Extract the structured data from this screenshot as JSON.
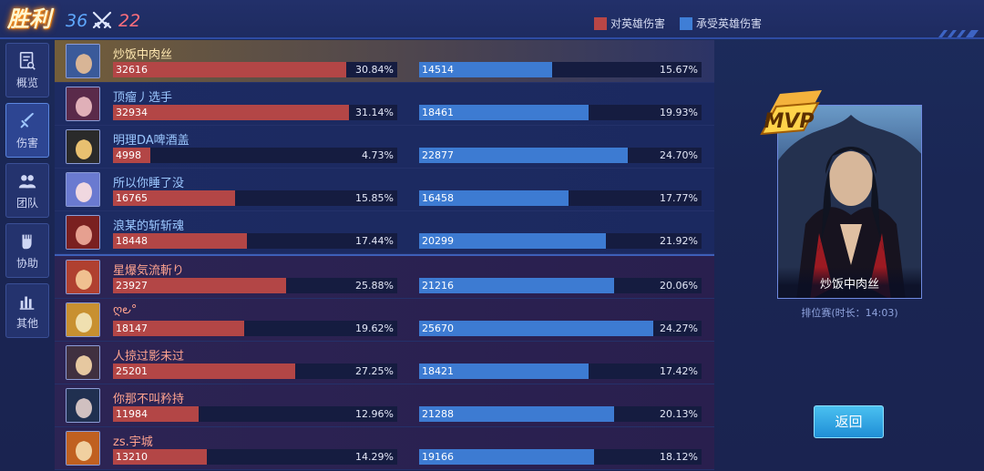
{
  "header": {
    "result_label": "胜利",
    "blue_kills": "36",
    "red_kills": "22",
    "legend_dmg": "对英雄伤害",
    "legend_taken": "承受英雄伤害",
    "colors": {
      "dmg": "#b34646",
      "taken": "#3d7bd2"
    }
  },
  "sidebar": {
    "items": [
      {
        "label": "概览",
        "icon": "document-icon",
        "active": false
      },
      {
        "label": "伤害",
        "icon": "sword-icon",
        "active": true
      },
      {
        "label": "团队",
        "icon": "team-icon",
        "active": false
      },
      {
        "label": "协助",
        "icon": "fist-icon",
        "active": false
      },
      {
        "label": "其他",
        "icon": "chart-icon",
        "active": false
      }
    ]
  },
  "players": [
    {
      "name": "炒饭中肉丝",
      "team": "blue",
      "self": true,
      "dmg": "32616",
      "dmg_pct": "30.84%",
      "taken": "14514",
      "taken_pct": "15.67%",
      "dmg_fill": 0.82,
      "taken_fill": 0.47
    },
    {
      "name": "顶瘤丿选手",
      "team": "blue",
      "self": false,
      "dmg": "32934",
      "dmg_pct": "31.14%",
      "taken": "18461",
      "taken_pct": "19.93%",
      "dmg_fill": 0.83,
      "taken_fill": 0.6
    },
    {
      "name": "明理DA啤酒盖",
      "team": "blue",
      "self": false,
      "dmg": "4998",
      "dmg_pct": "4.73%",
      "taken": "22877",
      "taken_pct": "24.70%",
      "dmg_fill": 0.13,
      "taken_fill": 0.74
    },
    {
      "name": "所以你睡了没",
      "team": "blue",
      "self": false,
      "dmg": "16765",
      "dmg_pct": "15.85%",
      "taken": "16458",
      "taken_pct": "17.77%",
      "dmg_fill": 0.43,
      "taken_fill": 0.53
    },
    {
      "name": "浪某的斩斩魂",
      "team": "blue",
      "self": false,
      "dmg": "18448",
      "dmg_pct": "17.44%",
      "taken": "20299",
      "taken_pct": "21.92%",
      "dmg_fill": 0.47,
      "taken_fill": 0.66
    },
    {
      "name": "星爆気流斬り",
      "team": "red",
      "self": false,
      "dmg": "23927",
      "dmg_pct": "25.88%",
      "taken": "21216",
      "taken_pct": "20.06%",
      "dmg_fill": 0.61,
      "taken_fill": 0.69
    },
    {
      "name": "ღ౿°",
      "team": "red",
      "self": false,
      "dmg": "18147",
      "dmg_pct": "19.62%",
      "taken": "25670",
      "taken_pct": "24.27%",
      "dmg_fill": 0.46,
      "taken_fill": 0.83
    },
    {
      "name": "人掠过影未过",
      "team": "red",
      "self": false,
      "dmg": "25201",
      "dmg_pct": "27.25%",
      "taken": "18421",
      "taken_pct": "17.42%",
      "dmg_fill": 0.64,
      "taken_fill": 0.6
    },
    {
      "name": "你那不叫矜持",
      "team": "red",
      "self": false,
      "dmg": "11984",
      "dmg_pct": "12.96%",
      "taken": "21288",
      "taken_pct": "20.13%",
      "dmg_fill": 0.3,
      "taken_fill": 0.69
    },
    {
      "name": "zs.宇城",
      "team": "red",
      "self": false,
      "dmg": "13210",
      "dmg_pct": "14.29%",
      "taken": "19166",
      "taken_pct": "18.12%",
      "dmg_fill": 0.33,
      "taken_fill": 0.62
    }
  ],
  "mvp": {
    "badge": "MVP",
    "name": "炒饭中肉丝",
    "match_info": "排位赛(时长：14:03)"
  },
  "back_button": "返回"
}
